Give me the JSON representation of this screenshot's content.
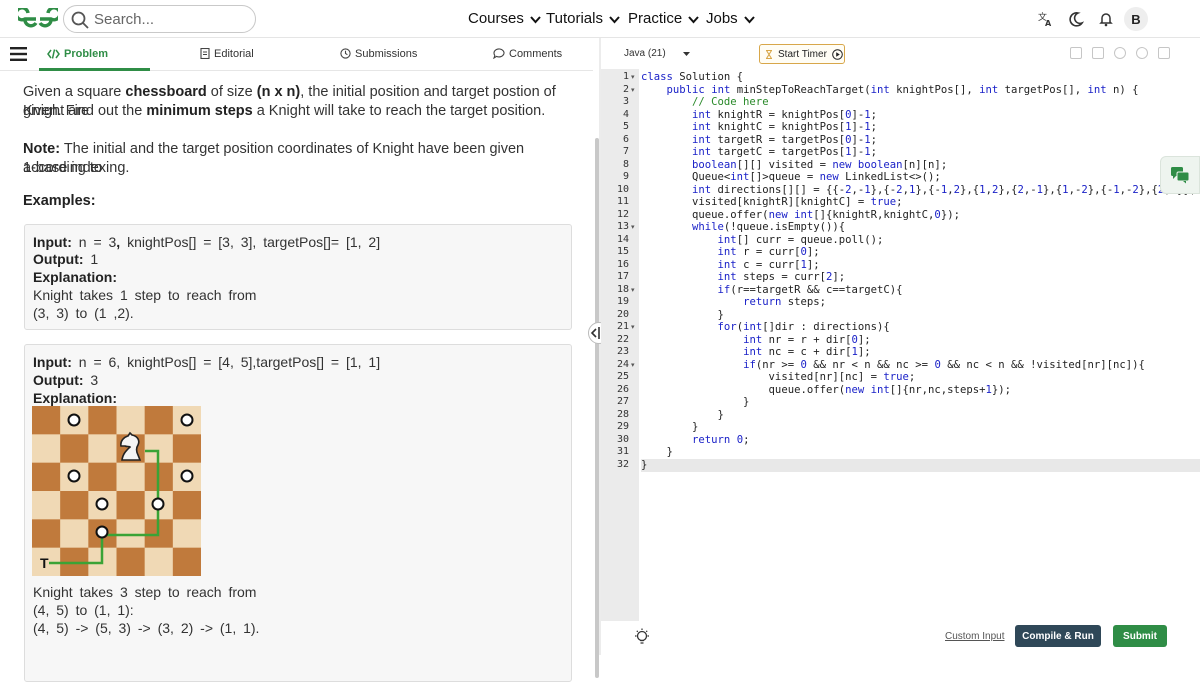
{
  "search": {
    "placeholder": "Search..."
  },
  "nav": [
    "Courses",
    "Tutorials",
    "Practice",
    "Jobs"
  ],
  "avatar": "B",
  "tabs": [
    "Problem",
    "Editorial",
    "Submissions",
    "Comments"
  ],
  "problem": {
    "intro_a": "Given a square ",
    "intro_b": "chessboard",
    "intro_c": " of size ",
    "intro_d": "(n x n)",
    "intro_e": ", the initial position and target postion of Knight are",
    "intro_f": "given. Find out the ",
    "intro_g": "minimum steps",
    "intro_h": " a Knight will take to reach the target position.",
    "note_label": "Note:",
    "note_a": " The initial and the target position coordinates of Knight have been given according to",
    "note_b": "1-base indexing.",
    "examples": "Examples:"
  },
  "example1": {
    "input_label": "Input:",
    "input": " n = 3",
    "input_comma": ",",
    "input_rest": " knightPos[] = [3, 3], targetPos[]= [1, 2]",
    "output_label": "Output:",
    "output": " 1",
    "explanation_label": "Explanation:",
    "line1": "Knight takes 1 step to reach from",
    "line2": "(3, 3) to (1 ,2)."
  },
  "example2": {
    "input_label": "Input:",
    "input": " n = 6, knightPos[] = [4, 5],targetPos[] = [1, 1]",
    "output_label": "Output:",
    "output": " 3",
    "explanation_label": "Explanation:",
    "board_target": "T",
    "line1": "Knight takes 3 step to reach from",
    "line2": "(4, 5) to (1, 1):",
    "line3": "(4, 5) -> (5, 3) -> (3, 2) -> (1, 1)."
  },
  "editor": {
    "language": "Java (21)",
    "timer": "Start Timer",
    "line_numbers": [
      "1",
      "2",
      "3",
      "4",
      "5",
      "6",
      "7",
      "8",
      "9",
      "10",
      "11",
      "12",
      "13",
      "14",
      "15",
      "16",
      "17",
      "18",
      "19",
      "20",
      "21",
      "22",
      "23",
      "24",
      "25",
      "26",
      "27",
      "28",
      "29",
      "30",
      "31",
      "32"
    ],
    "code": [
      "class Solution {",
      "    public int minStepToReachTarget(int knightPos[], int targetPos[], int n) {",
      "        // Code here",
      "        int knightR = knightPos[0]-1;",
      "        int knightC = knightPos[1]-1;",
      "        int targetR = targetPos[0]-1;",
      "        int targetC = targetPos[1]-1;",
      "        boolean[][] visited = new boolean[n][n];",
      "        Queue<int[]>queue = new LinkedList<>();",
      "        int directions[][] = {{-2,-1},{-2,1},{-1,2},{1,2},{2,-1},{1,-2},{-1,-2},{2,1}};",
      "        visited[knightR][knightC] = true;",
      "        queue.offer(new int[]{knightR,knightC,0});",
      "        while(!queue.isEmpty()){",
      "            int[] curr = queue.poll();",
      "            int r = curr[0];",
      "            int c = curr[1];",
      "            int steps = curr[2];",
      "            if(r==targetR && c==targetC){",
      "                return steps;",
      "            }",
      "            for(int[]dir : directions){",
      "                int nr = r + dir[0];",
      "                int nc = c + dir[1];",
      "                if(nr >= 0 && nr < n && nc >= 0 && nc < n && !visited[nr][nc]){",
      "                    visited[nr][nc] = true;",
      "                    queue.offer(new int[]{nr,nc,steps+1});",
      "                }",
      "            }",
      "        }",
      "        return 0;",
      "    }",
      "}"
    ],
    "custom_input": "Custom Input",
    "compile_run": "Compile & Run",
    "submit": "Submit"
  },
  "colors": {
    "brand": "#2f8d46",
    "compile": "#2f4858",
    "submit": "#2f8d46"
  },
  "icons": [
    "gfg-logo-icon",
    "search-icon",
    "chevron-down-icon",
    "translate-icon",
    "moon-icon",
    "bell-icon",
    "menu-icon",
    "code-icon",
    "document-icon",
    "clock-icon",
    "comment-icon",
    "chat-icon",
    "bulb-icon",
    "split-handle-icon",
    "play-icon",
    "timer-icon",
    "knight-icon"
  ]
}
